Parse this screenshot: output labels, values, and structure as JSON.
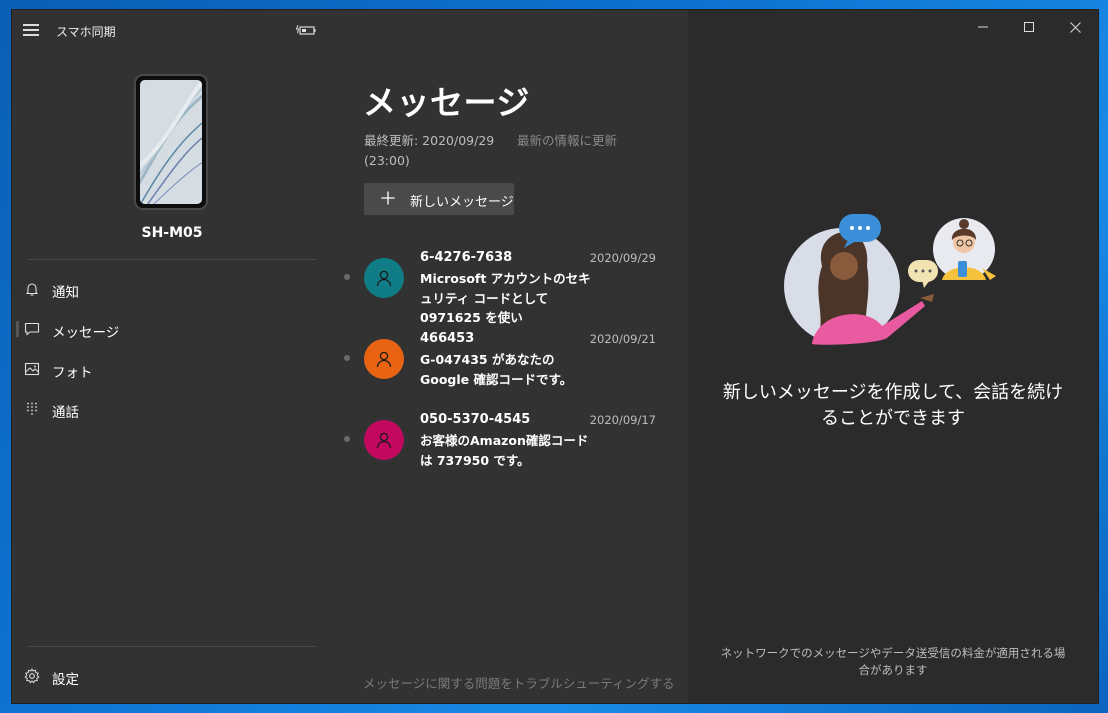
{
  "app": {
    "title": "スマホ同期",
    "device_name": "SH-M05"
  },
  "nav": {
    "items": [
      {
        "label": "通知",
        "icon": "bell-icon"
      },
      {
        "label": "メッセージ",
        "icon": "message-icon"
      },
      {
        "label": "フォト",
        "icon": "photo-icon"
      },
      {
        "label": "通話",
        "icon": "dialpad-icon"
      }
    ],
    "settings_label": "設定"
  },
  "messages": {
    "title": "メッセージ",
    "last_updated": "最終更新: 2020/09/29 (23:00)",
    "refresh_label": "最新の情報に更新",
    "new_message_label": "新しいメッセージ",
    "conversations": [
      {
        "sender": "6-4276-7638",
        "date": "2020/09/29",
        "preview": "Microsoft アカウントのセキュリティ コードとして 0971625 を使い",
        "avatar_color": "#0f7c86"
      },
      {
        "sender": "466453",
        "date": "2020/09/21",
        "preview": "G-047435 があなたの Google 確認コードです。",
        "avatar_color": "#e86412"
      },
      {
        "sender": "050-5370-4545",
        "date": "2020/09/17",
        "preview": "お客様のAmazon確認コードは 737950 です。",
        "avatar_color": "#c3095f"
      }
    ],
    "troubleshoot_link": "メッセージに関する問題をトラブルシューティングする"
  },
  "detail": {
    "empty_text": "新しいメッセージを作成して、会話を続けることができます",
    "footer_note": "ネットワークでのメッセージやデータ送受信の料金が適用される場合があります"
  },
  "colors": {
    "sidebar_bg": "#323232",
    "pane_bg": "#2b2b2b",
    "desktop": "#0e73d2"
  }
}
